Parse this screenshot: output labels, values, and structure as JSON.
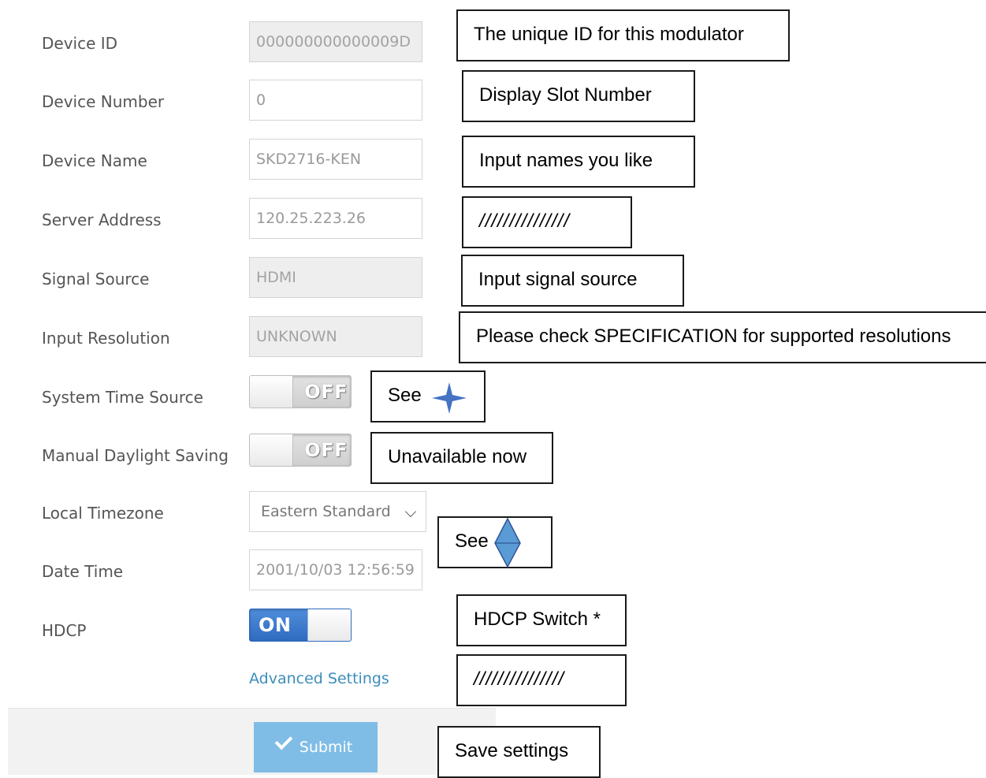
{
  "form": {
    "device_id": {
      "label": "Device ID",
      "value": "000000000000009D"
    },
    "device_number": {
      "label": "Device Number",
      "value": "0"
    },
    "device_name": {
      "label": "Device Name",
      "value": "SKD2716-KEN"
    },
    "server_address": {
      "label": "Server Address",
      "value": "120.25.223.26"
    },
    "signal_source": {
      "label": "Signal Source",
      "value": "HDMI"
    },
    "input_resolution": {
      "label": "Input Resolution",
      "value": "UNKNOWN"
    },
    "system_time_source": {
      "label": "System Time Source",
      "state": "OFF"
    },
    "manual_daylight_saving": {
      "label": "Manual Daylight Saving",
      "state": "OFF"
    },
    "local_timezone": {
      "label": "Local Timezone",
      "selected": "Eastern Standard"
    },
    "date_time": {
      "label": "Date Time",
      "value": "2001/10/03 12:56:59"
    },
    "hdcp": {
      "label": "HDCP",
      "state": "ON"
    },
    "advanced_settings_link": "Advanced Settings",
    "submit_label": "Submit"
  },
  "annotations": {
    "device_id": "The unique ID for this modulator",
    "device_number": "Display Slot Number",
    "device_name": "Input names you like",
    "server_address": "///////////////",
    "signal_source": "Input signal source",
    "input_resolution": "Please check SPECIFICATION for supported resolutions",
    "system_time_source": "See",
    "manual_daylight_saving": "Unavailable now",
    "local_timezone": "See",
    "hdcp": "HDCP Switch *",
    "advanced_settings": "///////////////",
    "submit": "Save settings"
  },
  "icons": {
    "system_time_source_marker": "four-point-star-icon",
    "local_timezone_marker": "diamond-icon",
    "submit_icon": "checkmark-icon",
    "dropdown_icon": "chevron-down-icon"
  },
  "colors": {
    "link": "#3c8dbc",
    "submit_button": "#7fbde6",
    "toggle_on": "#3a7bd0",
    "marker_star": "#4472c4",
    "marker_diamond": "#5b9bd5"
  }
}
